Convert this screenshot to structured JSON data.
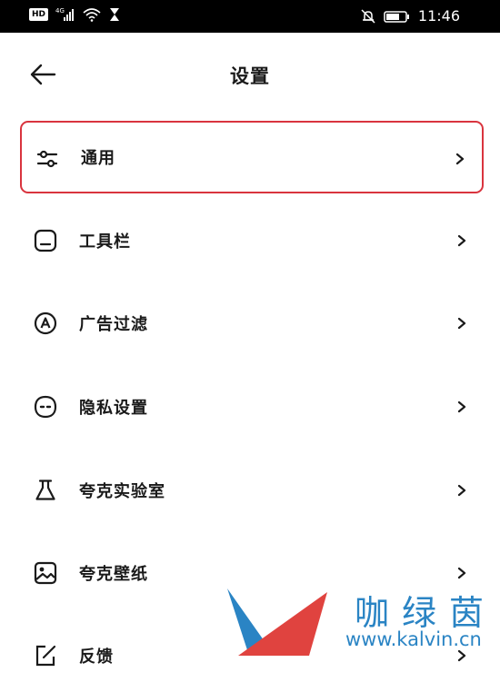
{
  "status_bar": {
    "network_badge": "HD",
    "network_type": "4G",
    "time": "11:46"
  },
  "header": {
    "title": "设置"
  },
  "menu": [
    {
      "label": "通用",
      "icon": "sliders-icon",
      "selected": true
    },
    {
      "label": "工具栏",
      "icon": "toolbar-icon",
      "selected": false
    },
    {
      "label": "广告过滤",
      "icon": "ad-filter-icon",
      "selected": false
    },
    {
      "label": "隐私设置",
      "icon": "privacy-face-icon",
      "selected": false
    },
    {
      "label": "夸克实验室",
      "icon": "flask-icon",
      "selected": false
    },
    {
      "label": "夸克壁纸",
      "icon": "wallpaper-icon",
      "selected": false
    },
    {
      "label": "反馈",
      "icon": "feedback-icon",
      "selected": false
    }
  ],
  "watermark": {
    "text": "咖绿茵",
    "url": "www.kalvin.cn"
  },
  "colors": {
    "selection_border": "#d9343e",
    "watermark_blue": "#2a84c4",
    "watermark_red": "#e0433f"
  }
}
